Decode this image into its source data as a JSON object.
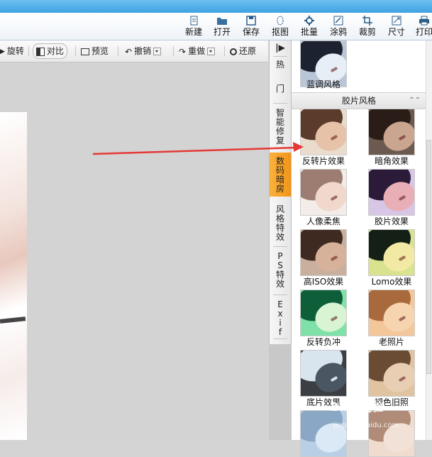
{
  "menu": {
    "items": [
      {
        "label": "新建",
        "icon": "new-file-icon"
      },
      {
        "label": "打开",
        "icon": "open-folder-icon"
      },
      {
        "label": "保存",
        "icon": "save-icon"
      },
      {
        "label": "抠图",
        "icon": "cutout-icon"
      },
      {
        "label": "批量",
        "icon": "batch-icon"
      },
      {
        "label": "涂鸦",
        "icon": "doodle-icon"
      },
      {
        "label": "裁剪",
        "icon": "crop-icon"
      },
      {
        "label": "尺寸",
        "icon": "resize-icon"
      },
      {
        "label": "打印",
        "icon": "print-icon"
      }
    ]
  },
  "toolbar": {
    "rotate_label": "旋转",
    "compare_label": "对比",
    "preview_label": "预览",
    "undo_label": "撤销",
    "redo_label": "重做",
    "restore_label": "还原"
  },
  "vtabs": {
    "collapse_icon": "collapse-panel-icon",
    "items": [
      {
        "label": [
          "热",
          "门"
        ],
        "active": false
      },
      {
        "label": [
          "智",
          "能",
          "修",
          "复"
        ],
        "active": false
      },
      {
        "label": [
          "数",
          "码",
          "暗",
          "房"
        ],
        "active": true
      },
      {
        "label": [
          "风",
          "格",
          "特",
          "效"
        ],
        "active": false
      },
      {
        "label": [
          "P",
          "S",
          "特",
          "效"
        ],
        "active": false
      },
      {
        "label": [
          "E",
          "x",
          "i",
          "f"
        ],
        "active": false
      }
    ]
  },
  "panel": {
    "top_item": {
      "label": "蓝调风格"
    },
    "section_title": "胶片风格",
    "effects": [
      {
        "label": "反转片效果"
      },
      {
        "label": "暗角效果"
      },
      {
        "label": "人像柔焦"
      },
      {
        "label": "胶片效果"
      },
      {
        "label": "高ISO效果"
      },
      {
        "label": "Lomo效果"
      },
      {
        "label": "反转负冲"
      },
      {
        "label": "老照片"
      },
      {
        "label": "底片效果"
      },
      {
        "label": "褪色旧照"
      }
    ]
  },
  "colors": {
    "title_bar": "#3ea2e2",
    "active_tab": "#f29417",
    "arrow": "#e53935"
  }
}
